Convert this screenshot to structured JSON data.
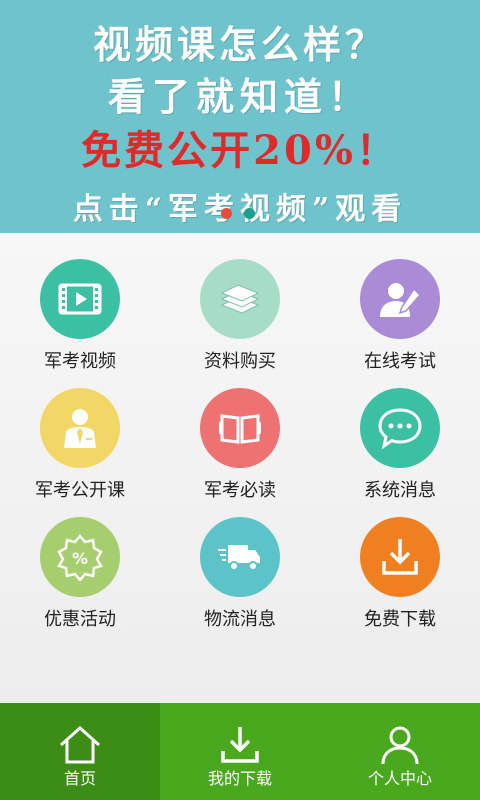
{
  "banner": {
    "line1": "视频课怎么样？",
    "line2": "看了就知道！",
    "line3": "免费公开20%！",
    "line4": "点击“军考视频”观看",
    "dot_colors": [
      "#e84b3c",
      "#1e9e8c"
    ]
  },
  "grid": {
    "items": [
      {
        "label": "军考视频",
        "icon": "video-film-icon",
        "color": "#3cc0a4"
      },
      {
        "label": "资料购买",
        "icon": "books-stack-icon",
        "color": "#a6dcc8"
      },
      {
        "label": "在线考试",
        "icon": "user-pen-icon",
        "color": "#a98bd6"
      },
      {
        "label": "军考公开课",
        "icon": "teacher-icon",
        "color": "#f2d666"
      },
      {
        "label": "军考必读",
        "icon": "open-book-icon",
        "color": "#ef7272"
      },
      {
        "label": "系统消息",
        "icon": "chat-bubble-icon",
        "color": "#3cc0a4"
      },
      {
        "label": "优惠活动",
        "icon": "discount-badge-icon",
        "color": "#a6cd6e"
      },
      {
        "label": "物流消息",
        "icon": "delivery-truck-icon",
        "color": "#5cc4c9"
      },
      {
        "label": "免费下载",
        "icon": "download-icon",
        "color": "#f07f22"
      }
    ]
  },
  "nav": {
    "items": [
      {
        "label": "首页",
        "icon": "home-icon"
      },
      {
        "label": "我的下载",
        "icon": "download-icon"
      },
      {
        "label": "个人中心",
        "icon": "user-icon"
      }
    ],
    "active_color": "#3b8d16",
    "bar_color": "#4aa81e"
  }
}
